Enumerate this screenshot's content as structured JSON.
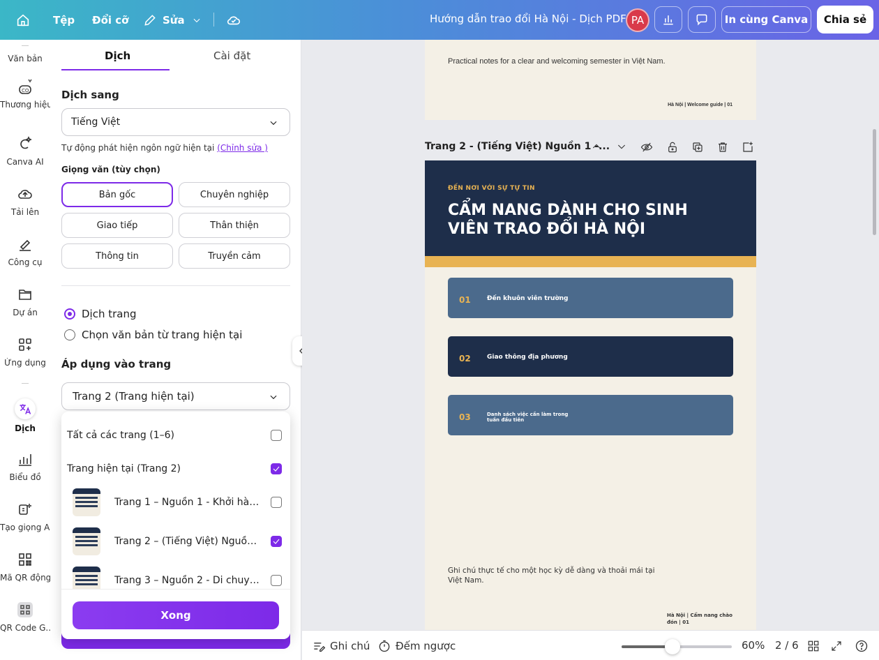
{
  "header": {
    "file_label": "Tệp",
    "resize_label": "Đổi cỡ",
    "edit_label": "Sửa",
    "doc_title": "Hướng dẫn trao đổi Hà Nội - Dịch PDF",
    "avatar_initials": "PA",
    "print_label": "In cùng Canva",
    "share_label": "Chia sẻ"
  },
  "rail": {
    "items": [
      {
        "label": "Văn bản",
        "icon": "text-icon"
      },
      {
        "label": "Thương hiệu",
        "icon": "brand-icon"
      },
      {
        "label": "Canva AI",
        "icon": "canva-ai-icon"
      },
      {
        "label": "Tải lên",
        "icon": "upload-icon"
      },
      {
        "label": "Công cụ",
        "icon": "tools-icon"
      },
      {
        "label": "Dự án",
        "icon": "folder-icon"
      },
      {
        "label": "Ứng dụng",
        "icon": "apps-icon"
      },
      {
        "label": "Dịch",
        "icon": "translate-icon"
      },
      {
        "label": "Biểu đồ",
        "icon": "chart-icon"
      },
      {
        "label": "Tạo giọng AI",
        "icon": "ai-voice-icon"
      },
      {
        "label": "Mã QR động",
        "icon": "qr-icon"
      },
      {
        "label": "QR Code G...",
        "icon": "qr-app-icon"
      }
    ]
  },
  "panel": {
    "tabs": [
      {
        "label": "Dịch"
      },
      {
        "label": "Cài đặt"
      }
    ],
    "translate_to_label": "Dịch sang",
    "language_value": "Tiếng Việt",
    "auto_detect_text": "Tự động phát hiện ngôn ngữ hiện tại",
    "auto_detect_link": "(Chỉnh sửa )",
    "tone_label": "Giọng văn (tùy chọn)",
    "tones": [
      "Bản gốc",
      "Chuyên nghiệp",
      "Giao tiếp",
      "Thân thiện",
      "Thông tin",
      "Truyền cảm"
    ],
    "selected_tone": "Bản gốc",
    "radio_translate_page": "Dịch trang",
    "radio_select_text": "Chọn văn bản từ trang hiện tại",
    "apply_label": "Áp dụng vào trang",
    "apply_value": "Trang 2 (Trang hiện tại)"
  },
  "dropdown": {
    "all_pages": "Tất cả các trang (1–6)",
    "current_page": "Trang hiện tại (Trang 2)",
    "pages": [
      {
        "label": "Trang 1 – Nguồn 1 - Khởi hành...",
        "checked": false
      },
      {
        "label": "Trang 2 – (Tiếng Việt) Nguồn 1...",
        "checked": true
      },
      {
        "label": "Trang 3 – Nguồn 2 - Di chuyển ...",
        "checked": false
      }
    ],
    "done_label": "Xong"
  },
  "canvas": {
    "page1_text": "Practical notes for a clear and welcoming semester in Việt Nam.",
    "page1_footer": "Hà Nội | Welcome guide | 01",
    "page2_header": "Trang 2 - (Tiếng Việt) Nguồn 1 -...",
    "page2_kicker": "ĐẾN NƠI VỚI SỰ TỰ TIN",
    "page2_title": "CẨM NANG DÀNH CHO SINH VIÊN TRAO ĐỔI HÀ NỘI",
    "cards": [
      {
        "num": "01",
        "text": "Đến khuôn viên trường"
      },
      {
        "num": "02",
        "text": "Giao thông địa phương"
      },
      {
        "num": "03",
        "text": "Danh sách việc cần làm trong tuần đầu tiên"
      }
    ],
    "page2_note": "Ghi chú thực tế cho một học kỳ dễ dàng và thoải mái tại Việt Nam.",
    "page2_footer": "Hà Nội | Cẩm nang chào đón | 01"
  },
  "bottom": {
    "notes_label": "Ghi chú",
    "timer_label": "Đếm ngược",
    "zoom": "60%",
    "page_counter": "2 / 6"
  },
  "colors": {
    "accent": "#7d2ae8",
    "navy": "#1e2e4a",
    "gold": "#e8b353",
    "slate": "#4b6a8c"
  }
}
